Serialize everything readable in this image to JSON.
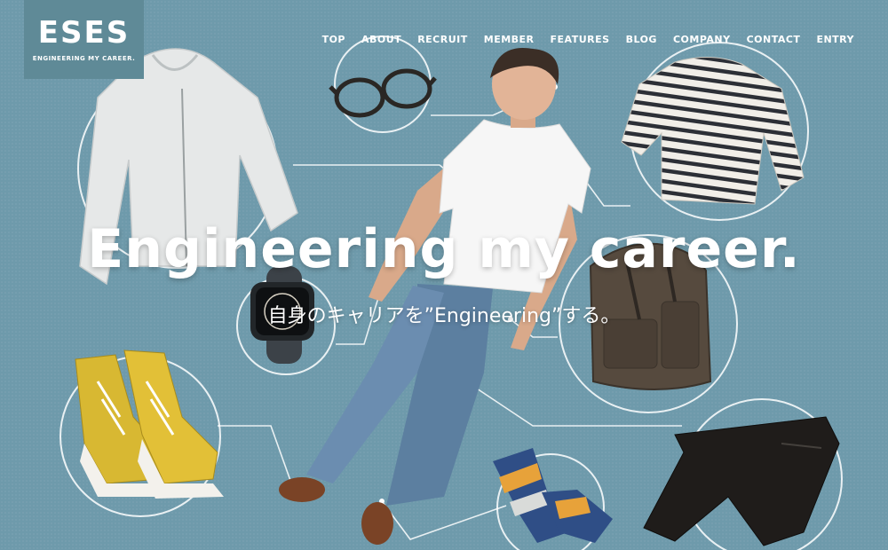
{
  "brand": {
    "name": "ESES",
    "tagline": "ENGINEERING MY CAREER."
  },
  "nav": [
    "TOP",
    "ABOUT",
    "RECRUIT",
    "MEMBER",
    "FEATURES",
    "BLOG",
    "COMPANY",
    "CONTACT",
    "ENTRY"
  ],
  "hero": {
    "headline": "Engineering my career.",
    "subline": "自身のキャリアを”Engineering”する。"
  },
  "colors": {
    "background": "#6e9aab",
    "logo_bg": "#5f8a97",
    "text": "#ffffff"
  },
  "icons": [
    "hoodie-icon",
    "glasses-icon",
    "sweater-icon",
    "watch-icon",
    "backpack-icon",
    "sneakers-icon",
    "socks-icon",
    "pants-icon"
  ]
}
